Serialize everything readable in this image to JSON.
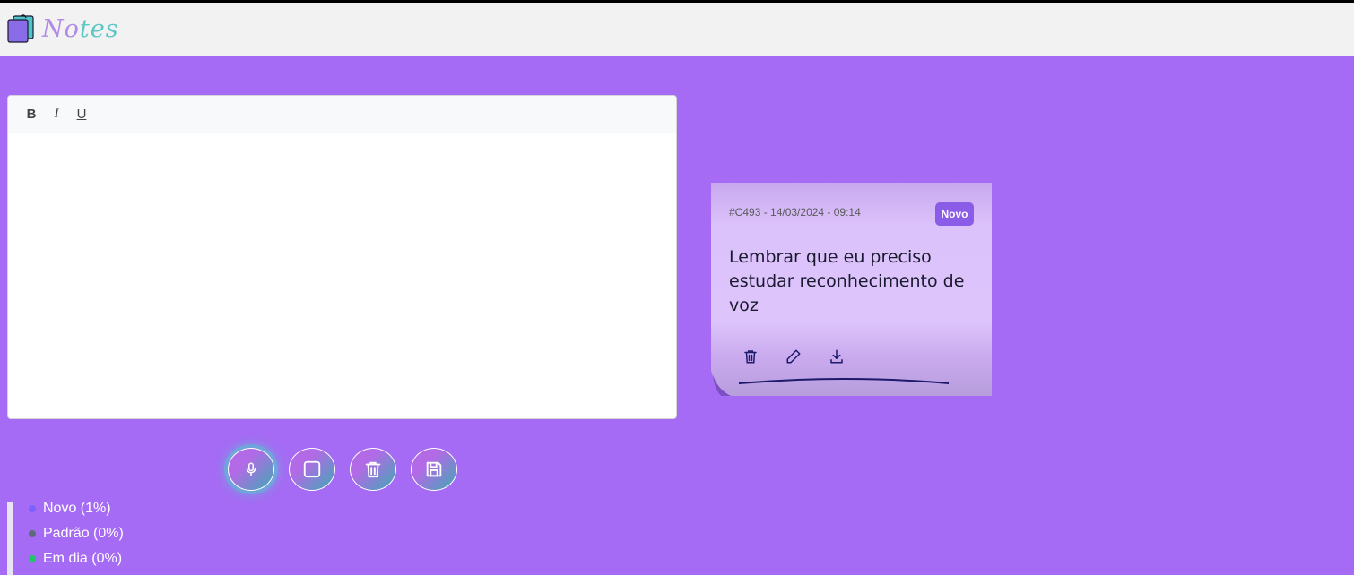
{
  "app": {
    "brand_first": "No",
    "brand_rest": "tes"
  },
  "editor": {
    "toolbar": {
      "bold": "B",
      "italic": "I",
      "underline": "U"
    },
    "content": ""
  },
  "controls": [
    {
      "name": "record-button",
      "icon": "microphone-icon"
    },
    {
      "name": "stop-button",
      "icon": "square-icon"
    },
    {
      "name": "clear-button",
      "icon": "trash-icon"
    },
    {
      "name": "save-button",
      "icon": "floppy-disk-icon"
    }
  ],
  "legend": {
    "items": [
      {
        "label": "Novo (1%)",
        "color": "#7b61ff"
      },
      {
        "label": "Padrão (0%)",
        "color": "#5a6b7a"
      },
      {
        "label": "Em dia (0%)",
        "color": "#20c46a"
      }
    ]
  },
  "note": {
    "meta": "#C493 - 14/03/2024 - 09:14",
    "badge": "Novo",
    "text": "Lembrar que eu preciso estudar reconhecimento de voz",
    "actions": [
      "trash-icon",
      "pencil-icon",
      "download-icon"
    ]
  },
  "colors": {
    "background": "#a56bf4",
    "navbar": "#f2f2f2",
    "badge": "#8a5ce8",
    "note": "#ddc4fb",
    "icon_dark": "#1d1a6b"
  }
}
